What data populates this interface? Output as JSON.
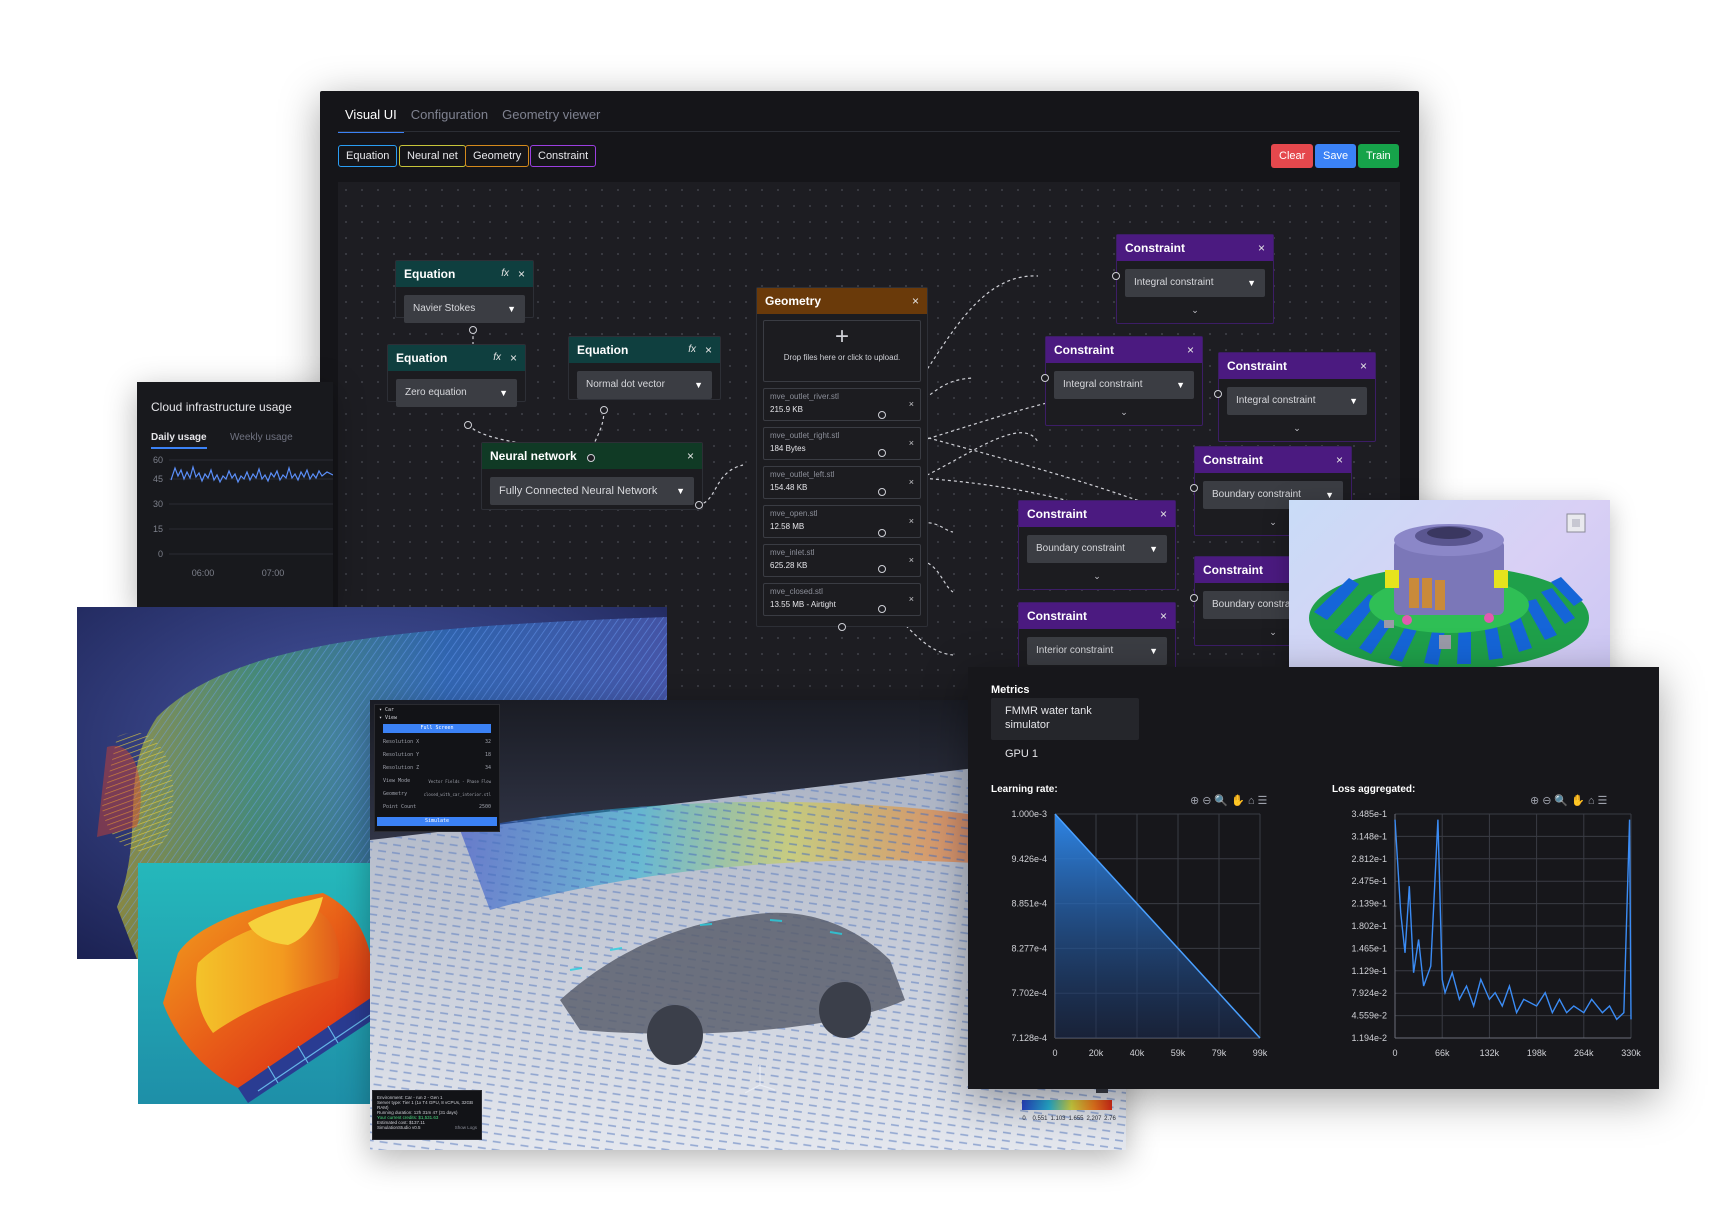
{
  "main": {
    "tabs": [
      "Visual UI",
      "Configuration",
      "Geometry viewer"
    ],
    "chips": [
      {
        "label": "Equation",
        "color": "#2a9df4"
      },
      {
        "label": "Neural net",
        "color": "#c8c43a"
      },
      {
        "label": "Geometry",
        "color": "#d48a1c"
      },
      {
        "label": "Constraint",
        "color": "#9b3fe0"
      }
    ],
    "actions": {
      "clear": "Clear",
      "save": "Save",
      "train": "Train"
    },
    "colors": {
      "clear": "#e5484d",
      "save": "#3b82f6",
      "train": "#16a34a"
    },
    "nodes": {
      "eq1": {
        "title": "Equation",
        "value": "Navier Stokes"
      },
      "eq2": {
        "title": "Equation",
        "value": "Zero equation"
      },
      "eq3": {
        "title": "Equation",
        "value": "Normal dot vector"
      },
      "nn": {
        "title": "Neural network",
        "value": "Fully Connected Neural Network"
      },
      "geometry": {
        "title": "Geometry",
        "drop_text": "Drop files here or click to upload.",
        "files": [
          {
            "name": "mve_outlet_river.stl",
            "size": "215.9 KB"
          },
          {
            "name": "mve_outlet_right.stl",
            "size": "184 Bytes"
          },
          {
            "name": "mve_outlet_left.stl",
            "size": "154.48 KB"
          },
          {
            "name": "mve_open.stl",
            "size": "12.58 MB"
          },
          {
            "name": "mve_inlet.stl",
            "size": "625.28 KB"
          },
          {
            "name": "mve_closed.stl",
            "size": "13.55 MB - Airtight"
          }
        ]
      },
      "c1": {
        "title": "Constraint",
        "value": "Integral constraint"
      },
      "c2": {
        "title": "Constraint",
        "value": "Integral constraint"
      },
      "c3": {
        "title": "Constraint",
        "value": "Integral constraint"
      },
      "c4": {
        "title": "Constraint",
        "value": "Boundary constraint"
      },
      "c5": {
        "title": "Constraint",
        "value": "Boundary constraint"
      },
      "c6": {
        "title": "Constraint",
        "value": "Boundary constraint"
      },
      "c7": {
        "title": "Constraint",
        "value": "Interior constraint"
      }
    },
    "close_glyph": "×",
    "fx_glyph": "fx"
  },
  "cloud": {
    "title": "Cloud infrastructure usage",
    "tabs": [
      "Daily usage",
      "Weekly usage"
    ],
    "y_ticks": [
      "60",
      "45",
      "30",
      "15",
      "0"
    ],
    "x_ticks": [
      "06:00",
      "07:00"
    ]
  },
  "sim_panel": {
    "header": "Car",
    "section": "View",
    "full_screen": "Full Screen",
    "rows": [
      {
        "label": "Resolution X",
        "value": "32"
      },
      {
        "label": "Resolution Y",
        "value": "18"
      },
      {
        "label": "Resolution Z",
        "value": "34"
      },
      {
        "label": "View Mode",
        "value": "Vector Fields - Phase Flow"
      },
      {
        "label": "Geometry",
        "value": "closed_with_car_interior.stl"
      },
      {
        "label": "Point Count",
        "value": "2500"
      }
    ],
    "simulate": "Simulate"
  },
  "info_box": {
    "lines": [
      "Environment: Car - run 2 - Gen 1",
      "Server type: Tier 1 (1x T4 GPU, 8 vCPUs, 32GB RAM)",
      "Running duration: 12h 31m 47 (31 days)",
      "Your current credits: $1,531.63",
      "Estimated cost: $137.11",
      "SimulationStudio v0.5"
    ],
    "show_logs": "Show Logs"
  },
  "colorbar": {
    "ticks": [
      "0",
      "0.551",
      "1.103",
      "1.655",
      "2.207",
      "2.76"
    ]
  },
  "metrics": {
    "title": "Metrics",
    "project": "FMMR water tank simulator",
    "gpu": "GPU 1",
    "toolbar": "⊕⊖🔍✋⌂☰"
  },
  "chart_data": [
    {
      "type": "area",
      "title": "Learning rate:",
      "x_ticks": [
        "0",
        "20k",
        "40k",
        "59k",
        "79k",
        "99k"
      ],
      "y_ticks": [
        "1.000e-3",
        "9.426e-4",
        "8.851e-4",
        "8.277e-4",
        "7.702e-4",
        "7.128e-4"
      ],
      "xlim": [
        0,
        99000
      ],
      "ylim": [
        0.0007128,
        0.001
      ],
      "grid": true,
      "series": [
        {
          "x": [
            0,
            99000
          ],
          "y": [
            0.001,
            0.0007128
          ]
        }
      ]
    },
    {
      "type": "line",
      "title": "Loss aggregated:",
      "x_ticks": [
        "0",
        "66k",
        "132k",
        "198k",
        "264k",
        "330k"
      ],
      "y_ticks": [
        "3.485e-1",
        "3.148e-1",
        "2.812e-1",
        "2.475e-1",
        "2.139e-1",
        "1.802e-1",
        "1.465e-1",
        "1.129e-1",
        "7.924e-2",
        "4.559e-2",
        "1.194e-2"
      ],
      "xlim": [
        0,
        330000
      ],
      "ylim": [
        0.01194,
        0.3485
      ],
      "grid": true,
      "series": [
        {
          "x": [
            0,
            8000,
            14000,
            20000,
            26000,
            33000,
            40000,
            50000,
            60000,
            66000,
            70000,
            80000,
            90000,
            100000,
            110000,
            120000,
            132000,
            140000,
            150000,
            160000,
            170000,
            180000,
            198000,
            210000,
            220000,
            230000,
            240000,
            250000,
            264000,
            275000,
            290000,
            300000,
            310000,
            320000,
            328000,
            330000
          ],
          "y": [
            0.34,
            0.2,
            0.14,
            0.24,
            0.11,
            0.16,
            0.09,
            0.12,
            0.34,
            0.1,
            0.08,
            0.11,
            0.07,
            0.09,
            0.06,
            0.1,
            0.07,
            0.08,
            0.06,
            0.09,
            0.05,
            0.07,
            0.06,
            0.08,
            0.05,
            0.07,
            0.05,
            0.06,
            0.05,
            0.07,
            0.05,
            0.06,
            0.04,
            0.05,
            0.34,
            0.04
          ]
        }
      ]
    }
  ]
}
